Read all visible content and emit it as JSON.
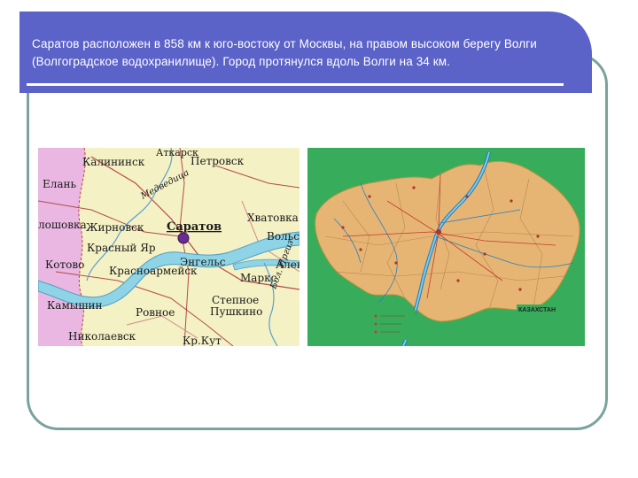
{
  "slide": {
    "title_text": "Саратов расположен в 858 км к юго-востоку от Москвы, на правом высоком берегу Волги (Волгоградское водохранилище). Город протянулся вдоль Волги на 34 км."
  },
  "map_left": {
    "labels": {
      "atkarsk": "Аткарск",
      "kalininsk": "Калининск",
      "petrovsk": "Петровск",
      "elan": "Елань",
      "medveditsa": "Медведица",
      "saratov": "Саратов",
      "khvatovka": "Хватовка",
      "balashovka": "лошовка",
      "zhirnovsk": "Жирновск",
      "volsk": "Вольск",
      "krasny_yar": "Красный Яр",
      "kotovo": "Котово",
      "engels": "Энгельс",
      "alek": "Алек",
      "krasnoarmeysk": "Красноармейск",
      "marks": "Маркс",
      "bolshoy_irgiz": "Бол. Иргиз",
      "kamyshin": "Камышин",
      "rovnoe": "Ровное",
      "stepnoe": "Степное",
      "pushkino": "Пушкино",
      "nikolaevsk": "Николаевск",
      "krasny_kut": "Кр.Кут"
    }
  },
  "map_right": {
    "labels": {
      "kazakhstan": "КАЗАХСТАН"
    }
  },
  "colors": {
    "banner": "#5b62c8",
    "frame_border": "#7aa39c",
    "map_left_pink": "#e9b7e1",
    "map_left_yellow": "#f4f1c4",
    "water": "#8fd4e6",
    "map_right_green": "#37ad5b",
    "map_right_region": "#e6b574"
  }
}
